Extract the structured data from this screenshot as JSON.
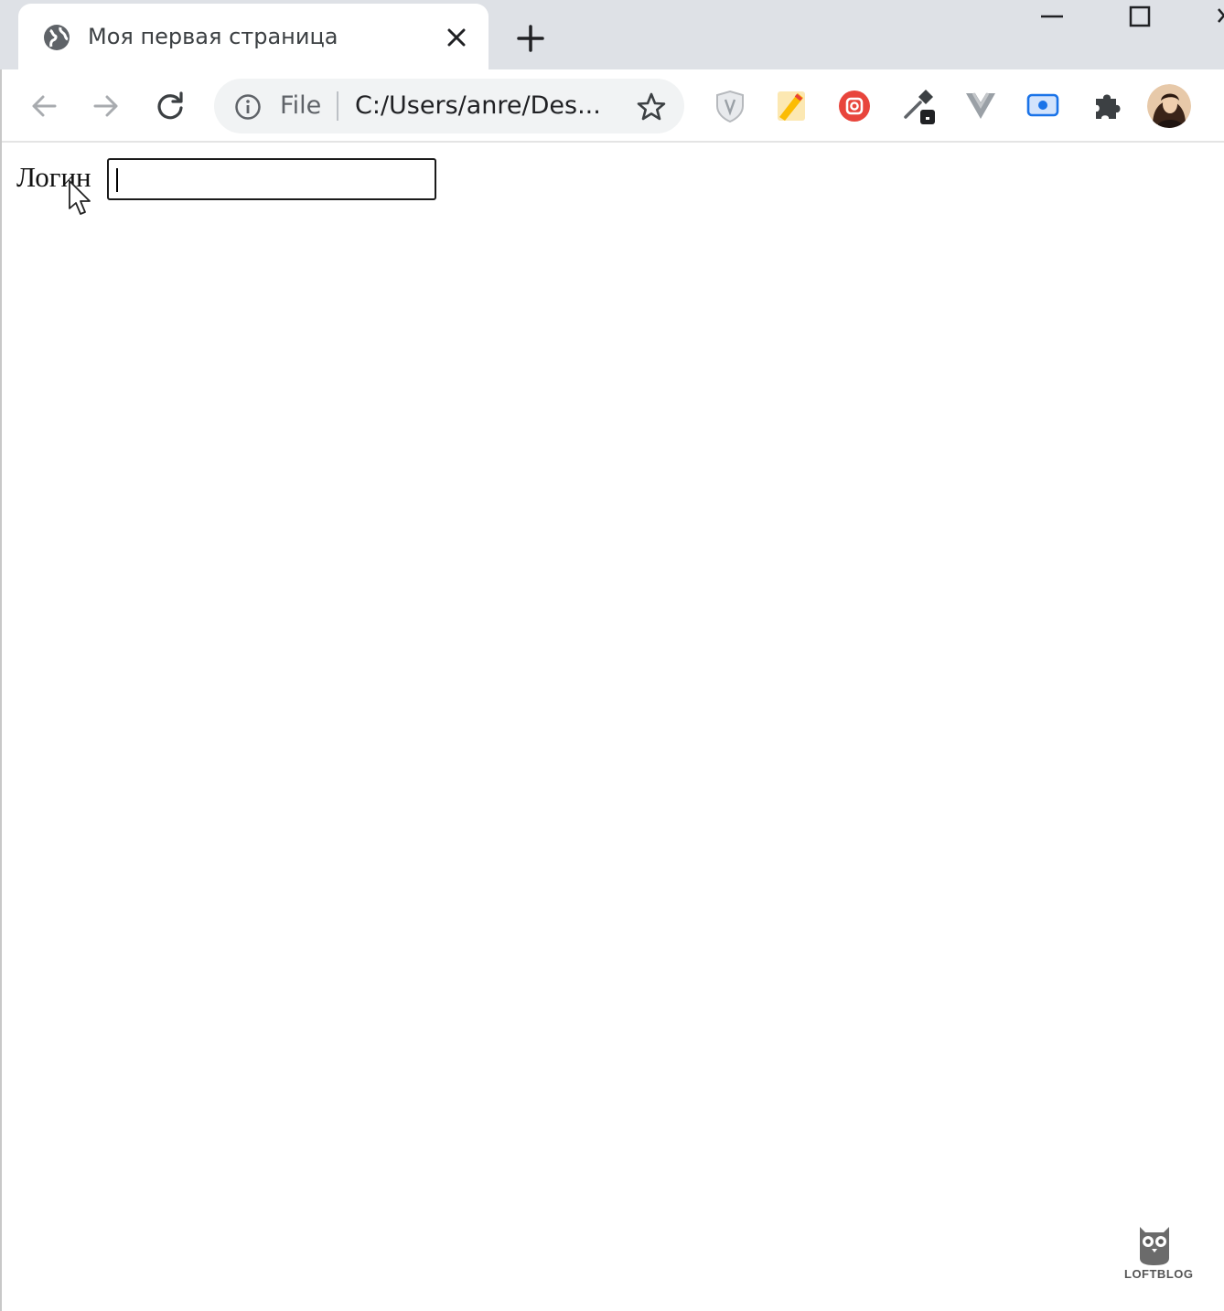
{
  "tab": {
    "title": "Моя первая страница",
    "favicon": "globe-icon"
  },
  "window_controls": [
    "minimize-icon",
    "maximize-icon",
    "close-icon"
  ],
  "toolbar": {
    "nav_icons": [
      "back-arrow-icon",
      "forward-arrow-icon",
      "reload-icon"
    ],
    "omnibox": {
      "security_icon": "info-icon",
      "scheme_label": "File",
      "url": "C:/Users/anre/Des..."
    },
    "bookmark_icon": "star-icon",
    "extensions": [
      "shield-extension-icon",
      "highlighter-extension-icon",
      "camera-extension-icon",
      "eyedropper-extension-icon",
      "vue-devtools-icon",
      "screen-capture-extension-icon",
      "puzzle-extensions-icon"
    ],
    "profile": "profile-avatar"
  },
  "page": {
    "login_label": "Логин",
    "login_value": ""
  },
  "watermark": {
    "text": "LOFTBLOG"
  },
  "colors": {
    "tabstrip": "#dee1e6",
    "omnibox": "#f1f3f4",
    "ext_orange": "#e8453c",
    "ext_blue": "#1a73e8"
  }
}
